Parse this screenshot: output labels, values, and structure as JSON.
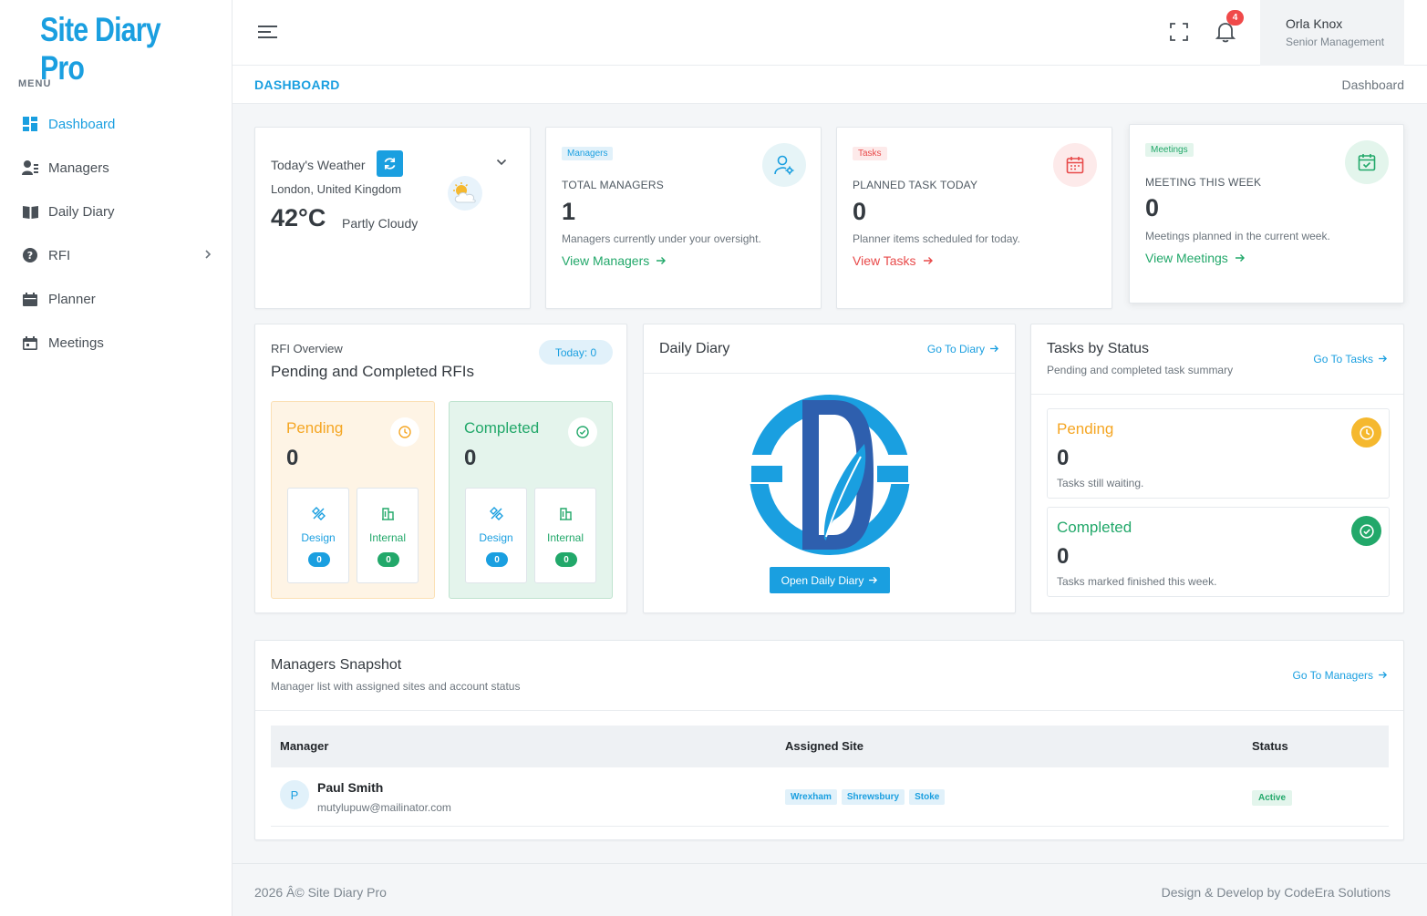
{
  "brand": "Site Diary Pro",
  "menu_title": "MENU",
  "nav": [
    {
      "label": "Dashboard",
      "icon": "dashboard-icon"
    },
    {
      "label": "Managers",
      "icon": "users-icon"
    },
    {
      "label": "Daily Diary",
      "icon": "book-icon"
    },
    {
      "label": "RFI",
      "icon": "question-icon"
    },
    {
      "label": "Planner",
      "icon": "calendar-icon"
    },
    {
      "label": "Meetings",
      "icon": "calendar-icon"
    }
  ],
  "topbar": {
    "notification_count": "4",
    "user_name": "Orla Knox",
    "user_role": "Senior Management"
  },
  "page": {
    "title": "DASHBOARD",
    "breadcrumb": "Dashboard"
  },
  "weather": {
    "title": "Today's Weather",
    "location": "London, United Kingdom",
    "temperature": "42°C",
    "condition": "Partly Cloudy"
  },
  "stats": [
    {
      "tag": "Managers",
      "label": "TOTAL MANAGERS",
      "value": "1",
      "desc": "Managers currently under your oversight.",
      "link": "View Managers"
    },
    {
      "tag": "Tasks",
      "label": "PLANNED TASK TODAY",
      "value": "0",
      "desc": "Planner items scheduled for today.",
      "link": "View Tasks"
    },
    {
      "tag": "Meetings",
      "label": "MEETING THIS WEEK",
      "value": "0",
      "desc": "Meetings planned in the current week.",
      "link": "View Meetings"
    }
  ],
  "rfi": {
    "subtitle": "RFI Overview",
    "title": "Pending and Completed RFIs",
    "today_badge": "Today: 0",
    "pending": {
      "label": "Pending",
      "value": "0",
      "design_label": "Design",
      "design_count": "0",
      "internal_label": "Internal",
      "internal_count": "0"
    },
    "completed": {
      "label": "Completed",
      "value": "0",
      "design_label": "Design",
      "design_count": "0",
      "internal_label": "Internal",
      "internal_count": "0"
    }
  },
  "diary": {
    "title": "Daily Diary",
    "link": "Go To Diary",
    "button": "Open Daily Diary"
  },
  "tasks_status": {
    "title": "Tasks by Status",
    "subtitle": "Pending and completed task summary",
    "link": "Go To Tasks",
    "pending": {
      "label": "Pending",
      "value": "0",
      "desc": "Tasks still waiting."
    },
    "completed": {
      "label": "Completed",
      "value": "0",
      "desc": "Tasks marked finished this week."
    }
  },
  "managers_snapshot": {
    "title": "Managers Snapshot",
    "subtitle": "Manager list with assigned sites and account status",
    "link": "Go To Managers",
    "columns": [
      "Manager",
      "Assigned Site",
      "Status"
    ],
    "rows": [
      {
        "initial": "P",
        "name": "Paul Smith",
        "email": "mutylupuw@mailinator.com",
        "sites": [
          "Wrexham",
          "Shrewsbury",
          "Stoke"
        ],
        "status": "Active"
      }
    ]
  },
  "footer": {
    "left": "2026 Â© Site Diary Pro",
    "right": "Design & Develop by CodeEra Solutions"
  },
  "colors": {
    "accent": "#1a9fe0",
    "pending": "#f5a623",
    "success": "#22a86a",
    "danger": "#e84a4a"
  }
}
